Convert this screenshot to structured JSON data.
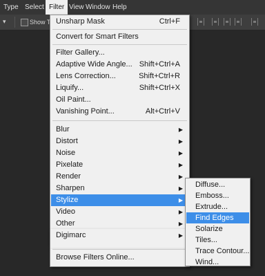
{
  "menubar": {
    "items": [
      {
        "label": "Type"
      },
      {
        "label": "Select"
      },
      {
        "label": "Filter"
      },
      {
        "label": "View"
      },
      {
        "label": "Window"
      },
      {
        "label": "Help"
      }
    ]
  },
  "options_bar": {
    "show_transform_label": "Show Tr"
  },
  "filter_menu": {
    "items": [
      {
        "label": "Unsharp Mask",
        "shortcut": "Ctrl+F"
      },
      {
        "label": "Convert for Smart Filters"
      },
      {
        "label": "Filter Gallery..."
      },
      {
        "label": "Adaptive Wide Angle...",
        "shortcut": "Shift+Ctrl+A"
      },
      {
        "label": "Lens Correction...",
        "shortcut": "Shift+Ctrl+R"
      },
      {
        "label": "Liquify...",
        "shortcut": "Shift+Ctrl+X"
      },
      {
        "label": "Oil Paint..."
      },
      {
        "label": "Vanishing Point...",
        "shortcut": "Alt+Ctrl+V"
      },
      {
        "label": "Blur"
      },
      {
        "label": "Distort"
      },
      {
        "label": "Noise"
      },
      {
        "label": "Pixelate"
      },
      {
        "label": "Render"
      },
      {
        "label": "Sharpen"
      },
      {
        "label": "Stylize"
      },
      {
        "label": "Video"
      },
      {
        "label": "Other"
      },
      {
        "label": "Digimarc"
      },
      {
        "label": "Browse Filters Online..."
      }
    ]
  },
  "stylize_submenu": {
    "items": [
      {
        "label": "Diffuse..."
      },
      {
        "label": "Emboss..."
      },
      {
        "label": "Extrude..."
      },
      {
        "label": "Find Edges"
      },
      {
        "label": "Solarize"
      },
      {
        "label": "Tiles..."
      },
      {
        "label": "Trace Contour..."
      },
      {
        "label": "Wind..."
      }
    ]
  },
  "colors": {
    "highlight": "#3d8ee8",
    "menu_bg": "#f0f0f0",
    "app_bg": "#282828"
  }
}
